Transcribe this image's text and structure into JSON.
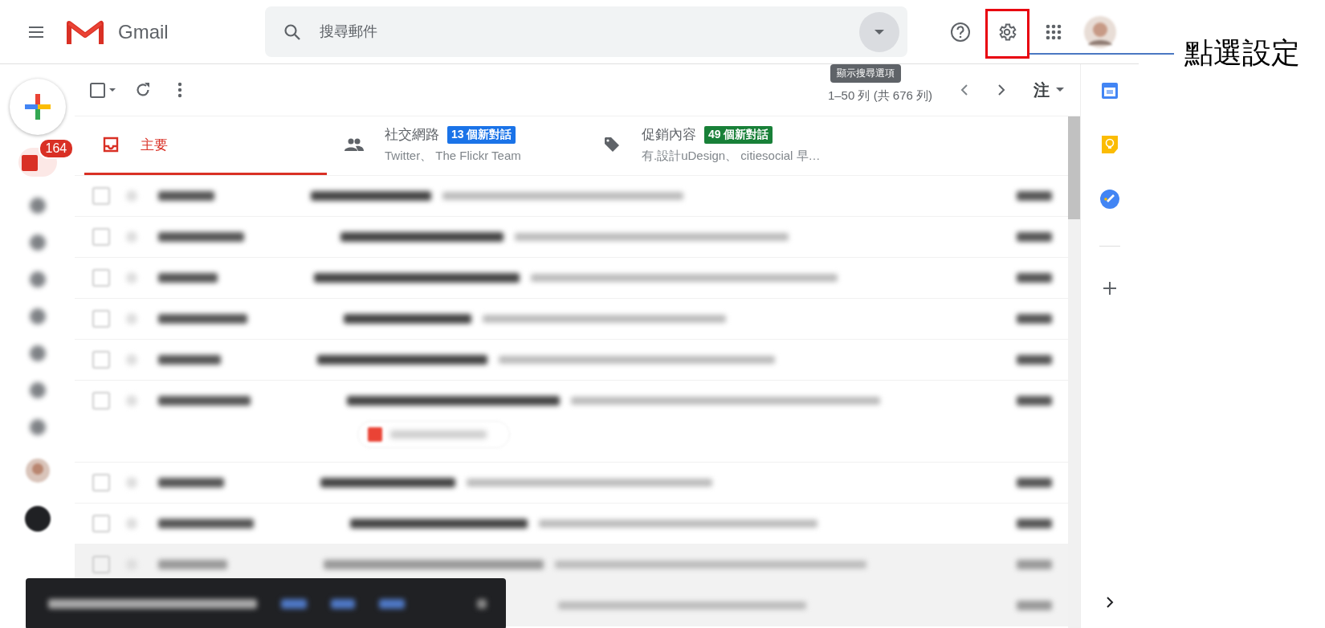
{
  "header": {
    "app_name": "Gmail",
    "search": {
      "placeholder": "搜尋郵件"
    }
  },
  "tooltip": "顯示搜尋選項",
  "annotation": {
    "label": "點選設定"
  },
  "toolbar": {
    "count": "1–50 列 (共 676 列)",
    "input_tool": "注",
    "select_all": {
      "checked": false
    }
  },
  "inbox_badge": "164",
  "tabs": [
    {
      "kind": "primary",
      "label": "主要",
      "selected": true
    },
    {
      "kind": "social",
      "label": "社交網路",
      "badge": "13 個新對話",
      "color": "#1a73e8",
      "senders": "Twitter、 The Flickr Team",
      "selected": false
    },
    {
      "kind": "promotions",
      "label": "促銷內容",
      "badge": "49 個新對話",
      "color": "#188038",
      "senders": "有.設計uDesign、 citiesocial 早…",
      "selected": false
    }
  ],
  "rows": [
    {
      "kind": "plain",
      "checked": false
    },
    {
      "kind": "plain",
      "checked": false
    },
    {
      "kind": "plain",
      "checked": false
    },
    {
      "kind": "plain",
      "checked": false
    },
    {
      "kind": "plain",
      "checked": false
    },
    {
      "kind": "attachment",
      "checked": false
    },
    {
      "kind": "plain",
      "checked": false
    },
    {
      "kind": "plain",
      "checked": false
    },
    {
      "kind": "shaded",
      "checked": false
    },
    {
      "kind": "shaded"
    }
  ]
}
